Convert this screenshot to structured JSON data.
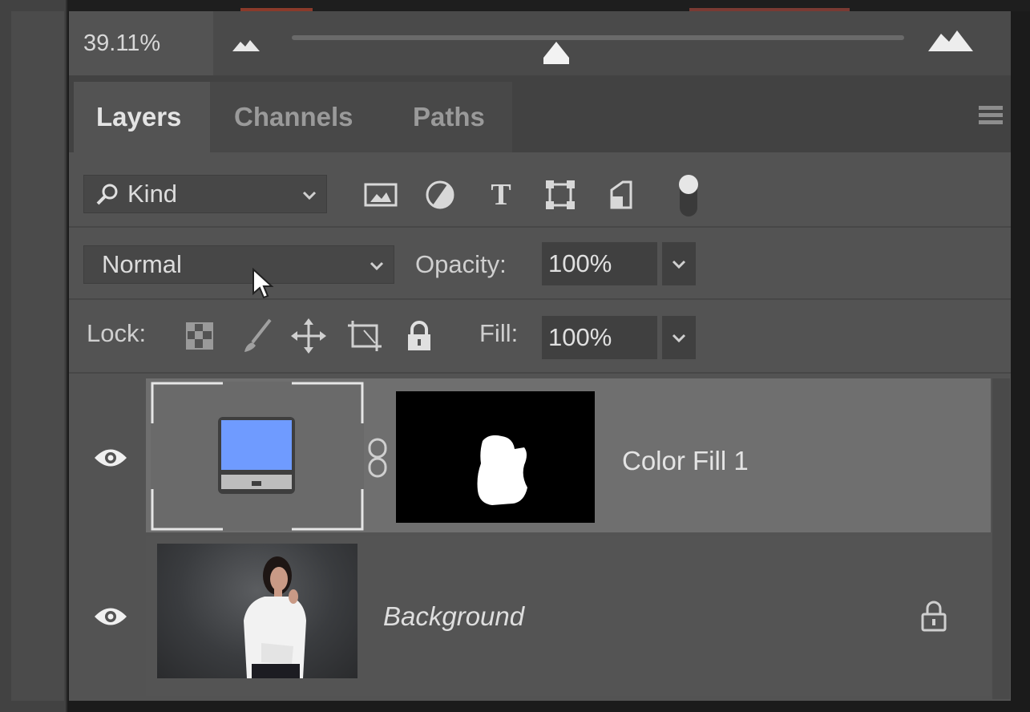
{
  "zoom": {
    "value": "39.11%",
    "slider_position": 0.43
  },
  "tabs": [
    {
      "label": "Layers",
      "active": true
    },
    {
      "label": "Channels",
      "active": false
    },
    {
      "label": "Paths",
      "active": false
    }
  ],
  "filter": {
    "kind_label": "Kind",
    "icons": [
      "image-filter-icon",
      "adjustment-filter-icon",
      "type-filter-icon",
      "shape-filter-icon",
      "smart-object-filter-icon"
    ]
  },
  "blend": {
    "mode": "Normal",
    "opacity_label": "Opacity:",
    "opacity_value": "100%"
  },
  "lock": {
    "label": "Lock:",
    "fill_label": "Fill:",
    "fill_value": "100%"
  },
  "layers": [
    {
      "name": "Color Fill 1",
      "visible": true,
      "selected": true,
      "fill_color": "#6f9bff"
    },
    {
      "name": "Background",
      "visible": true,
      "locked": true
    }
  ],
  "colors": {
    "panel": "#535353",
    "selected_layer": "#6f6f6f",
    "fill_swatch": "#6f9bff"
  }
}
